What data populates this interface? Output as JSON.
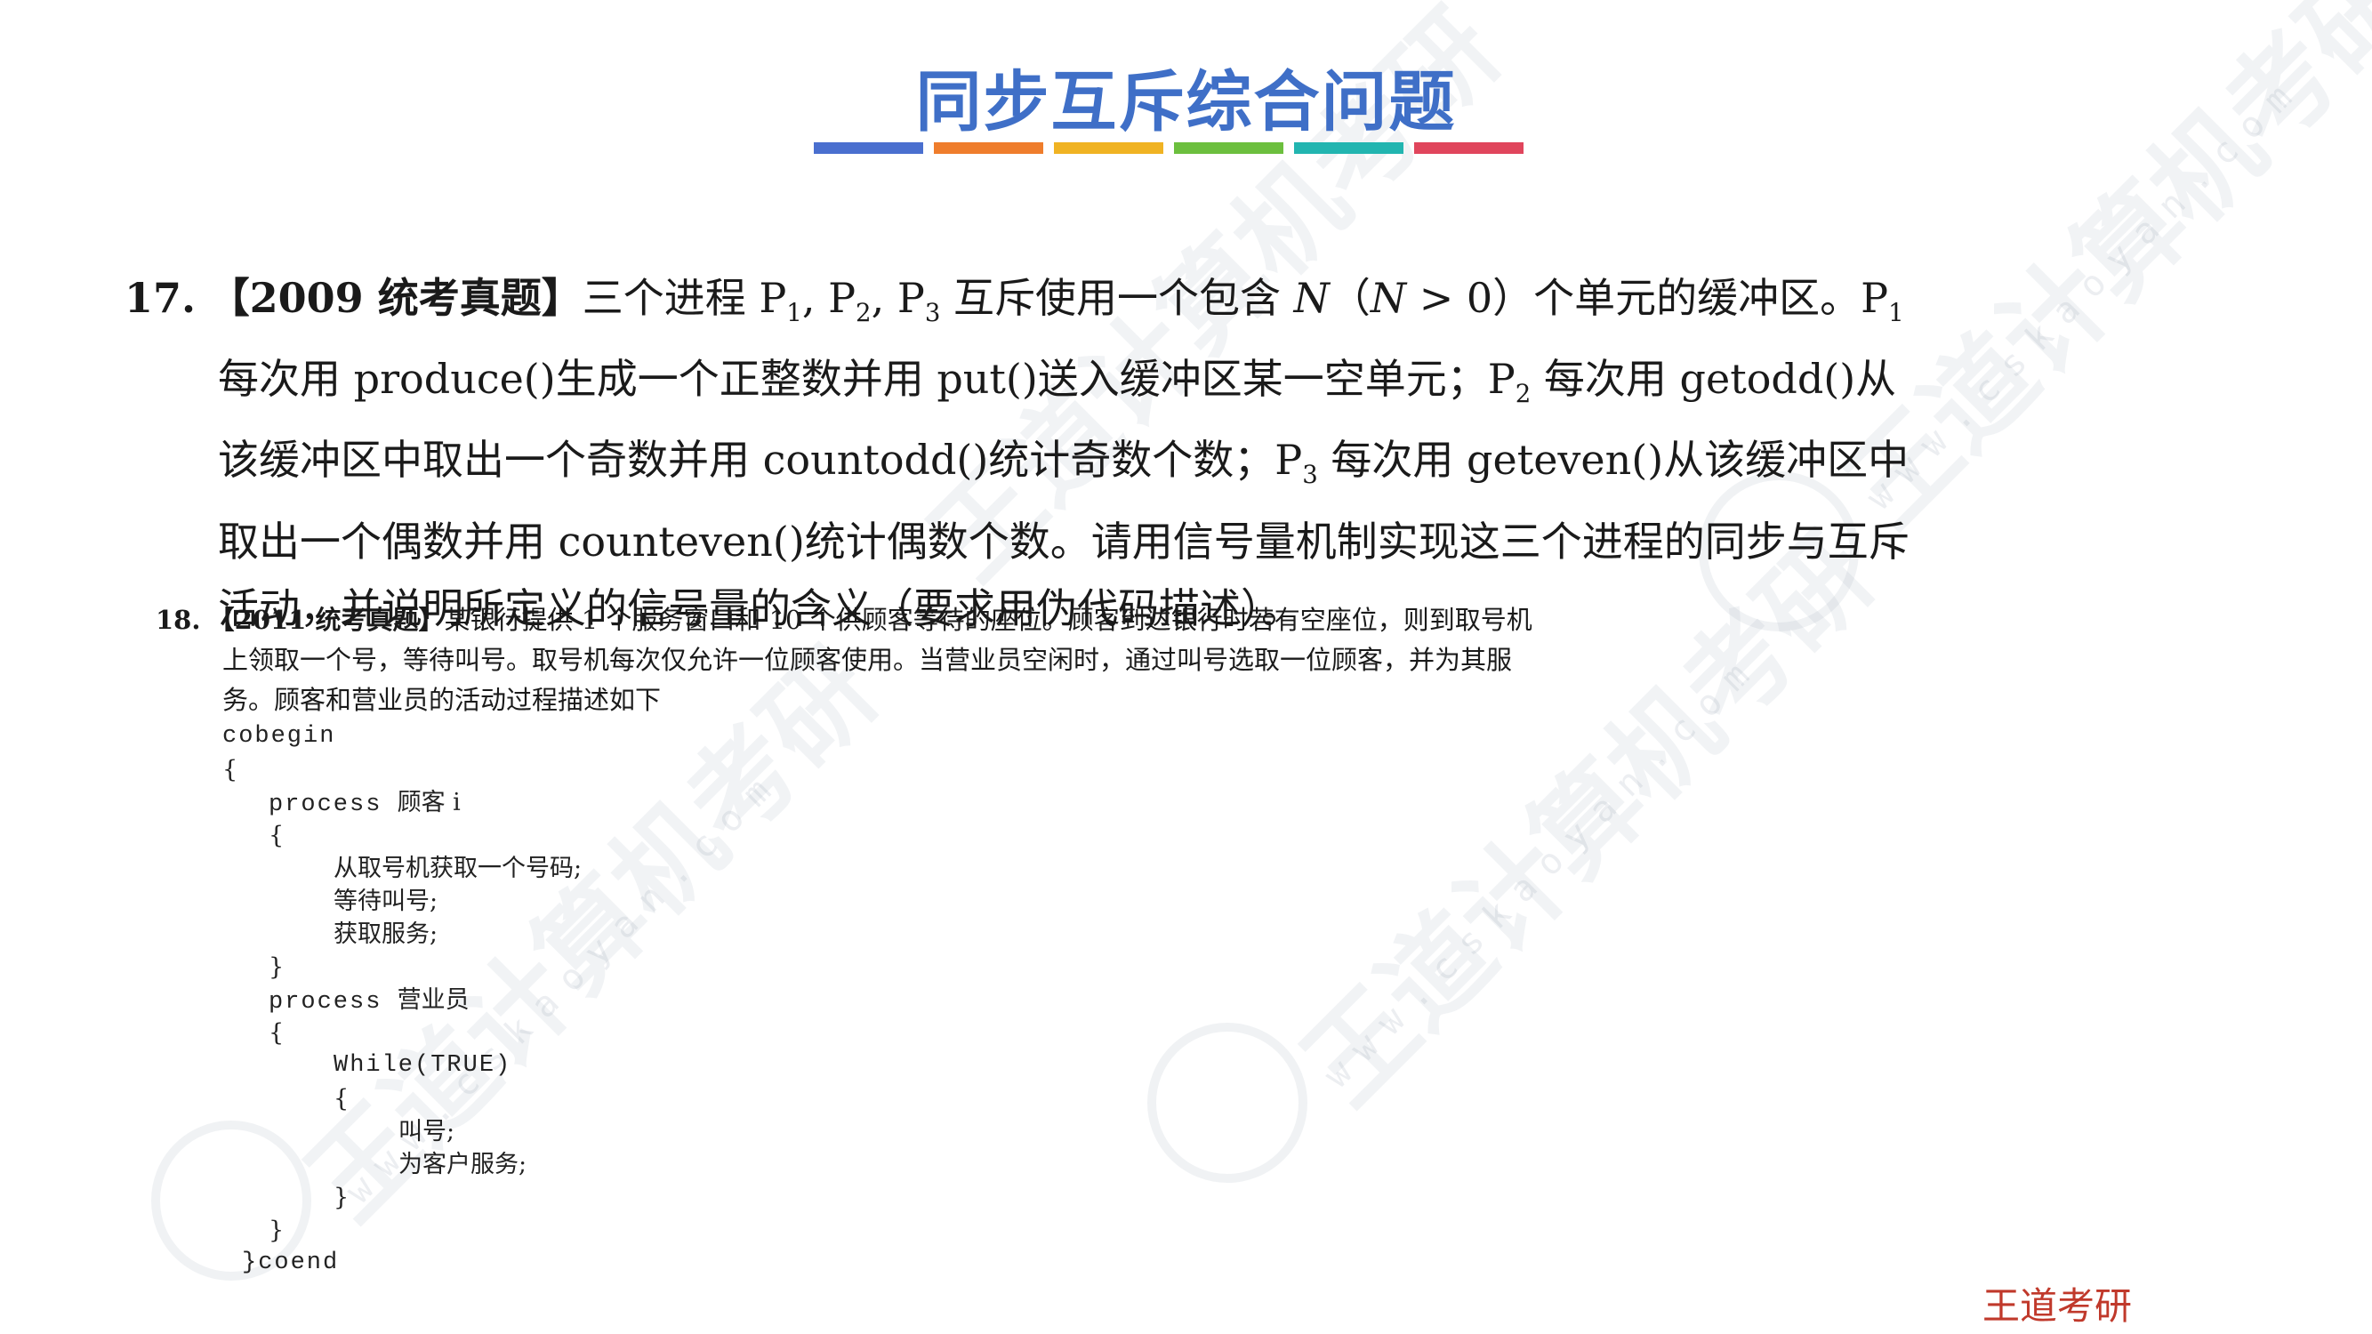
{
  "slide": {
    "title": "同步互斥综合问题",
    "title_bar_colors": [
      "#4a6fcf",
      "#ef7d2c",
      "#f0b323",
      "#6cbf3e",
      "#22b5b0",
      "#e0455c"
    ],
    "brand": "王道考研",
    "brand_color": "#c0392b"
  },
  "watermark": {
    "text": "王道计算机考研",
    "url": "www.cskaoyan.com"
  },
  "q17": {
    "number": "17.",
    "tag": "【2009 统考真题】",
    "text_parts": {
      "a": "三个进程 P",
      "a_sub1": "1",
      "b": ", P",
      "a_sub2": "2",
      "c": ", P",
      "a_sub3": "3",
      "d": " 互斥使用一个包含 ",
      "n1": "N",
      "e": "（",
      "n2": "N",
      "f": " > 0）个单元的缓冲区。P",
      "f_sub": "1",
      "g": "每次用 produce()生成一个正整数并用 put()送入缓冲区某一空单元；P",
      "g_sub": "2",
      "h": " 每次用 getodd()从该缓冲区中取出一个奇数并用 countodd()统计奇数个数；P",
      "h_sub": "3",
      "i": " 每次用 geteven()从该缓冲区中取出一个偶数并用 counteven()统计偶数个数。请用信号量机制实现这三个进程的同步与互斥活动，并说明所定义的信号量的含义（要求用伪代码描述）。"
    }
  },
  "q18": {
    "number": "18.",
    "tag": "【2011 统考真题】",
    "text": "某银行提供 1 个服务窗口和 10 个供顾客等待的座位。顾客到达银行时若有空座位，则到取号机上领取一个号，等待叫号。取号机每次仅允许一位顾客使用。当营业员空闲时，通过叫号选取一位顾客，并为其服务。顾客和营业员的活动过程描述如下"
  },
  "code": {
    "l1": "cobegin",
    "l2": "{",
    "l3_kw": "process",
    "l3_name": "顾客 i",
    "l4": "{",
    "l5": "从取号机获取一个号码;",
    "l6": "等待叫号;",
    "l7": "获取服务;",
    "l8": "}",
    "l9_kw": "process",
    "l9_name": "营业员",
    "l10": "{",
    "l11": "While(TRUE)",
    "l12": "{",
    "l13": "叫号;",
    "l14": "为客户服务;",
    "l15": "}",
    "l16": "}",
    "l17": "}coend"
  }
}
